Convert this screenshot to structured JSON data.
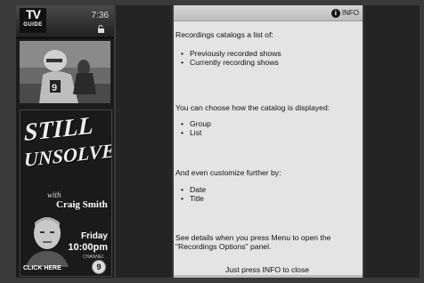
{
  "guide": {
    "logo_top": "TV",
    "logo_bottom": "GUIDE",
    "clock": "7:36",
    "lock_icon": "lock-icon"
  },
  "ad": {
    "title_line1": "STILL",
    "title_line2": "UNSOLVED",
    "with": "with",
    "host": "Craig Smith",
    "day": "Friday",
    "time": "10:00pm",
    "channel_label": "CHANNEL",
    "channel": "9",
    "cta": "CLICK HERE"
  },
  "info": {
    "badge_icon": "info-icon",
    "badge_letter": "i",
    "badge_label": "INFO",
    "section1": "Recordings catalogs a list of:",
    "section1_items": [
      "Previously recorded shows",
      "Currently recording shows"
    ],
    "section2": "You can choose how the catalog is displayed:",
    "section2_items": [
      "Group",
      "List"
    ],
    "section3": "And even customize further by:",
    "section3_items": [
      "Date",
      "Title"
    ],
    "section4": "See details when you press Menu to open the \"Recordings Options\" panel.",
    "close_hint": "Just press INFO to close"
  },
  "colors": {
    "panel_bg": "#e4e4e4",
    "frame_bg": "#3a3a3a",
    "dark_col": "#242424"
  }
}
